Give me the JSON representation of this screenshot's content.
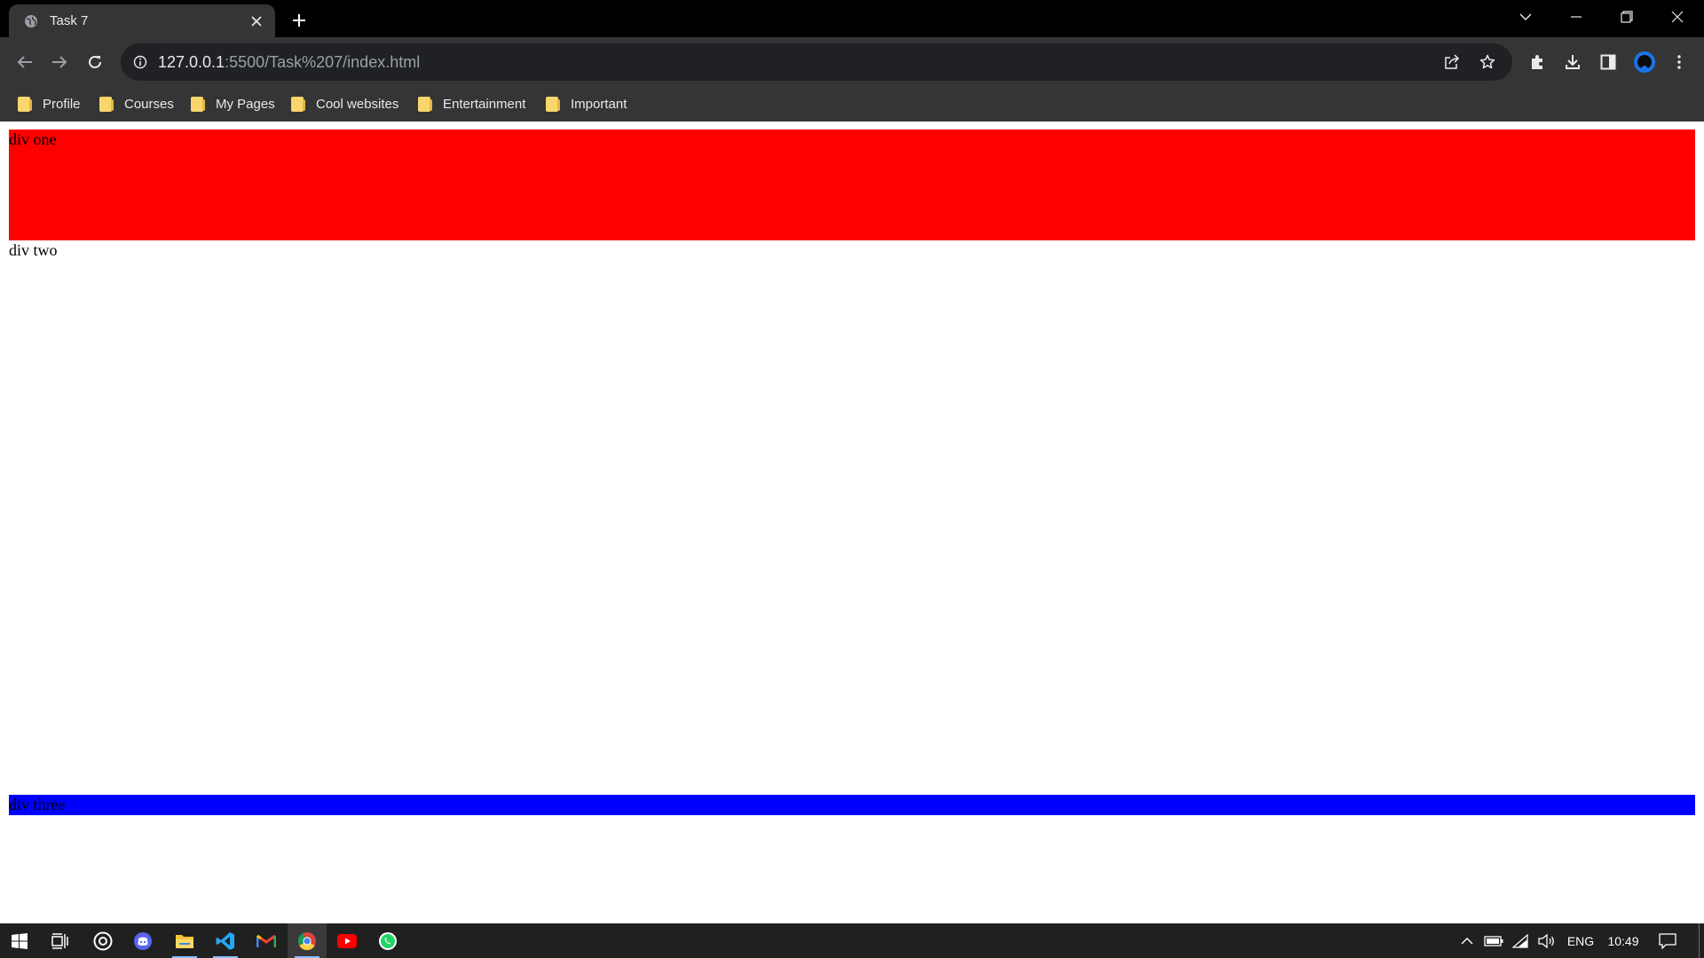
{
  "browser": {
    "tab": {
      "title": "Task 7",
      "favicon": "globe-icon",
      "close": "close-icon"
    },
    "new_tab": "plus-icon",
    "window_controls": [
      "tab-search-icon",
      "minimize-icon",
      "restore-icon",
      "close-icon"
    ],
    "url": {
      "host": "127.0.0.1",
      "path": ":5500/Task%207/index.html"
    },
    "toolbar_icons": [
      "share-icon",
      "star-icon",
      "extensions-icon",
      "download-icon",
      "side-panel-icon",
      "profile-avatar",
      "menu-icon"
    ],
    "bookmarks": [
      {
        "label": "Profile"
      },
      {
        "label": "Courses"
      },
      {
        "label": "My Pages"
      },
      {
        "label": "Cool websites"
      },
      {
        "label": "Entertainment"
      },
      {
        "label": "Important"
      }
    ]
  },
  "page": {
    "div_one": {
      "text": "div one",
      "color": "#ff0000"
    },
    "div_two": {
      "text": "div two"
    },
    "div_three": {
      "text": "div three",
      "color": "#0000ff"
    }
  },
  "taskbar": {
    "apps": [
      "windows-start-icon",
      "task-view-icon",
      "obs-icon",
      "discord-icon",
      "file-explorer-icon",
      "vscode-icon",
      "gmail-icon",
      "chrome-icon",
      "youtube-icon",
      "whatsapp-icon"
    ],
    "tray": {
      "language": "ENG",
      "time": "10:49"
    }
  }
}
